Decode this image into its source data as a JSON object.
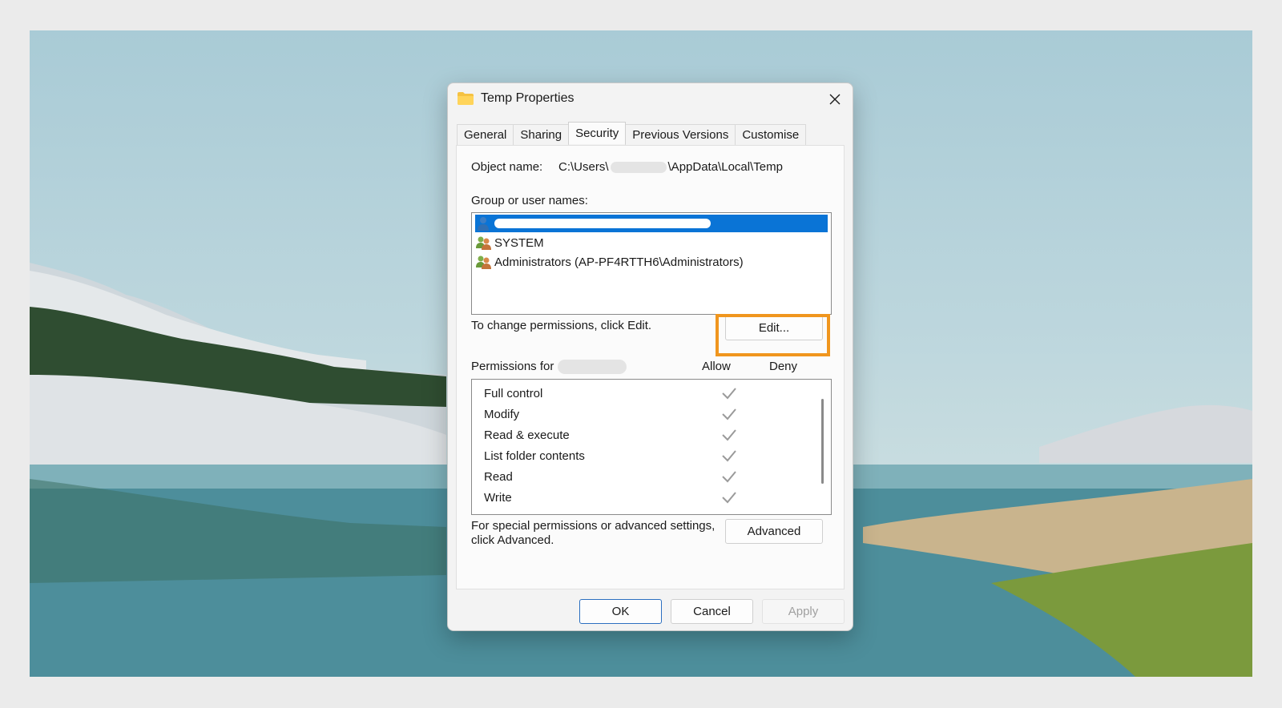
{
  "dialog": {
    "title": "Temp Properties",
    "tabs": [
      "General",
      "Sharing",
      "Security",
      "Previous Versions",
      "Customise"
    ],
    "active_tab": "Security",
    "object_name_label": "Object name:",
    "object_path_prefix": "C:\\Users\\",
    "object_path_suffix": "\\AppData\\Local\\Temp",
    "group_label": "Group or user names:",
    "users": [
      {
        "name": "",
        "icon": "user-icon",
        "selected": true
      },
      {
        "name": "SYSTEM",
        "icon": "group-icon",
        "selected": false
      },
      {
        "name": "Administrators (AP-PF4RTTH6\\Administrators)",
        "icon": "group-icon",
        "selected": false
      }
    ],
    "change_hint": "To change permissions, click Edit.",
    "edit_label": "Edit...",
    "permissions_for_label": "Permissions for",
    "allow_label": "Allow",
    "deny_label": "Deny",
    "permissions": [
      {
        "name": "Full control",
        "allow": true,
        "deny": false
      },
      {
        "name": "Modify",
        "allow": true,
        "deny": false
      },
      {
        "name": "Read & execute",
        "allow": true,
        "deny": false
      },
      {
        "name": "List folder contents",
        "allow": true,
        "deny": false
      },
      {
        "name": "Read",
        "allow": true,
        "deny": false
      },
      {
        "name": "Write",
        "allow": true,
        "deny": false
      }
    ],
    "advanced_hint_line1": "For special permissions or advanced settings,",
    "advanced_hint_line2": "click Advanced.",
    "advanced_label": "Advanced",
    "ok_label": "OK",
    "cancel_label": "Cancel",
    "apply_label": "Apply"
  },
  "colors": {
    "selection": "#0a74d6",
    "highlight": "#f0961e",
    "primary_border": "#2b6fc0"
  }
}
